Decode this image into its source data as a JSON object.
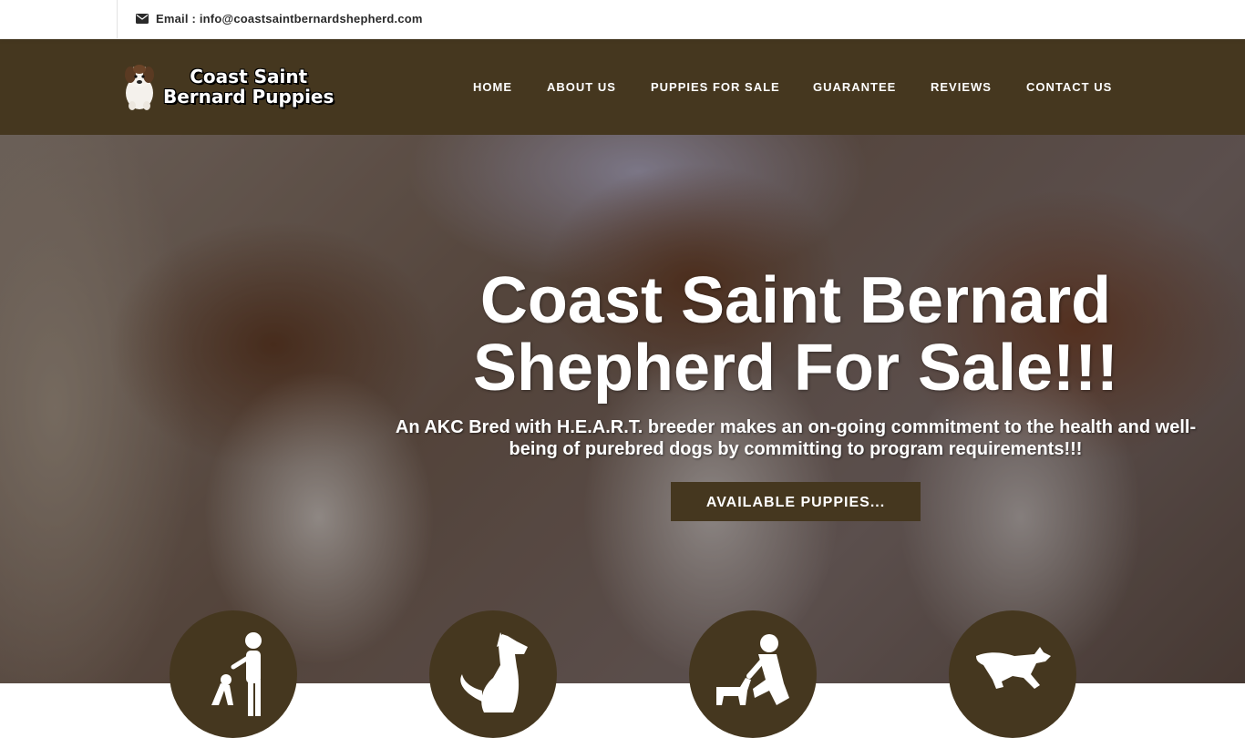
{
  "topbar": {
    "email_text": "Email : info@coastsaintbernardshepherd.com",
    "email_icon": "envelope-icon"
  },
  "header": {
    "logo_line1": "Coast Saint",
    "logo_line2": "Bernard Puppies",
    "nav": [
      {
        "label": "HOME"
      },
      {
        "label": "ABOUT US"
      },
      {
        "label": "PUPPIES FOR SALE"
      },
      {
        "label": "GUARANTEE"
      },
      {
        "label": "REVIEWS"
      },
      {
        "label": "CONTACT US"
      }
    ]
  },
  "hero": {
    "title_line1": "Coast Saint Bernard",
    "title_line2": "Shepherd For Sale!!!",
    "subtitle": "An AKC Bred with H.E.A.R.T. breeder makes an on-going commitment to the health and well-being of purebred dogs by committing to program requirements!!!",
    "button_label": "AVAILABLE PUPPIES..."
  },
  "features": [
    {
      "icon": "person-with-dog-icon"
    },
    {
      "icon": "sitting-dog-icon"
    },
    {
      "icon": "kneeling-person-with-dog-icon"
    },
    {
      "icon": "running-dog-icon"
    }
  ],
  "colors": {
    "brand_brown": "#45371f",
    "text_white": "#ffffff"
  }
}
